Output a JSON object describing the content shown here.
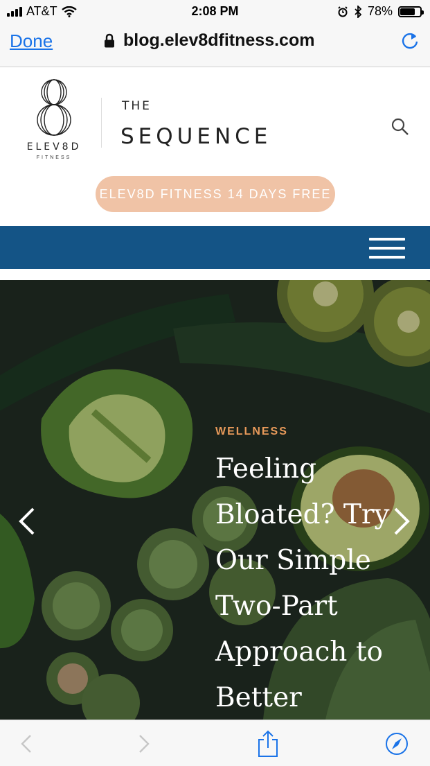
{
  "status_bar": {
    "carrier": "AT&T",
    "time": "2:08 PM",
    "battery": "78%",
    "battery_level": 0.78,
    "icons": [
      "signal-icon",
      "wifi-icon",
      "alarm-icon",
      "bluetooth-icon",
      "battery-icon"
    ]
  },
  "browser": {
    "done_label": "Done",
    "url": "blog.elev8dfitness.com",
    "icons": [
      "lock-icon",
      "reload-icon"
    ]
  },
  "site": {
    "logo_mark": "8",
    "brand": "ELEV8D",
    "brand_sub": "FITNESS",
    "publication_the": "THE",
    "publication_title": "SEQUENCE",
    "cta_label": "ELEV8D FITNESS 14 DAYS FREE",
    "colors": {
      "cta_bg": "#f0c3a6",
      "nav_bg": "#145486",
      "category": "#e89a5a"
    },
    "icons": [
      "search-icon",
      "hamburger-menu-icon"
    ]
  },
  "hero": {
    "category": "WELLNESS",
    "headline": "Feeling Bloated? Try Our Simple Two-Part Approach to Better",
    "icons": [
      "chevron-left-icon",
      "chevron-right-icon"
    ]
  },
  "toolbar": {
    "icons": [
      "back-icon",
      "forward-icon",
      "share-icon",
      "compass-icon"
    ]
  }
}
